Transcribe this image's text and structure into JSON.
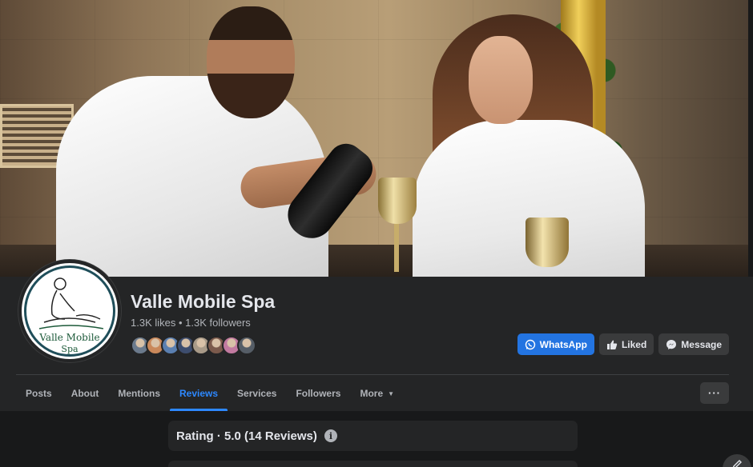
{
  "page": {
    "name": "Valle Mobile Spa",
    "stats": "1.3K likes • 1.3K followers",
    "logo_line1": "Valle  Mobile",
    "logo_line2": "Spa"
  },
  "friends": [
    "#6b7a8c",
    "#c9885a",
    "#5a7fb0",
    "#3d4d6e",
    "#a89a88",
    "#7b5a4c",
    "#c27aa0",
    "#555d66"
  ],
  "actions": {
    "whatsapp": "WhatsApp",
    "liked": "Liked",
    "message": "Message"
  },
  "tabs": [
    {
      "label": "Posts"
    },
    {
      "label": "About"
    },
    {
      "label": "Mentions"
    },
    {
      "label": "Reviews",
      "active": true
    },
    {
      "label": "Services"
    },
    {
      "label": "Followers"
    },
    {
      "label": "More"
    }
  ],
  "more_menu_label": "···",
  "reviews": {
    "rating_title": "Rating · 5.0 (14 Reviews)",
    "info_glyph": "i"
  },
  "colors": {
    "accent": "#2374e1",
    "tab_active": "#2d88ff",
    "card_bg": "#242526",
    "page_bg": "#18191a"
  }
}
